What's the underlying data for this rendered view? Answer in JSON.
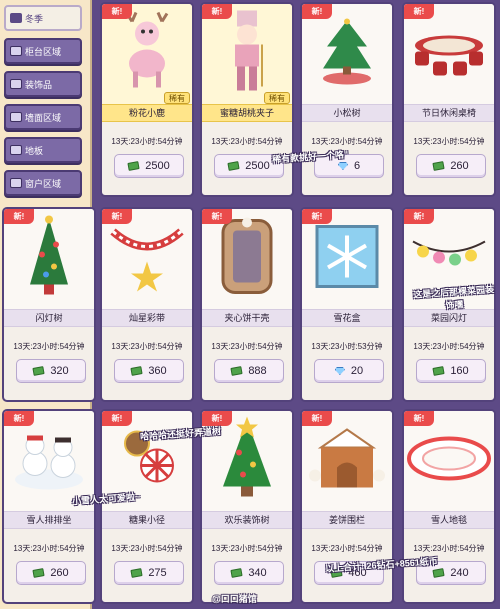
{
  "sidebar": {
    "items": [
      {
        "label": "冬季",
        "icon": "snowflake-icon"
      },
      {
        "label": "柜台区域",
        "icon": "counter-icon"
      },
      {
        "label": "装饰品",
        "icon": "decoration-icon"
      },
      {
        "label": "墙面区域",
        "icon": "wall-icon"
      },
      {
        "label": "地板",
        "icon": "floor-icon"
      },
      {
        "label": "窗户区域",
        "icon": "window-icon"
      }
    ]
  },
  "badges": {
    "new": "新!",
    "rare": "稀有"
  },
  "items": [
    {
      "name": "粉花小鹿",
      "timer": "13天:23小时:54分钟",
      "price": "2500",
      "currency": "cash",
      "rare": true
    },
    {
      "name": "蜜糖胡桃夹子",
      "timer": "13天:23小时:54分钟",
      "price": "2500",
      "currency": "cash",
      "rare": true
    },
    {
      "name": "小松树",
      "timer": "13天:23小时:54分钟",
      "price": "6",
      "currency": "gem",
      "rare": false
    },
    {
      "name": "节日休闲桌椅",
      "timer": "13天:23小时:54分钟",
      "price": "260",
      "currency": "cash",
      "rare": false
    },
    {
      "name": "闪灯树",
      "timer": "13天:23小时:54分钟",
      "price": "320",
      "currency": "cash",
      "rare": false
    },
    {
      "name": "灿星彩带",
      "timer": "13天:23小时:54分钟",
      "price": "360",
      "currency": "cash",
      "rare": false
    },
    {
      "name": "夹心饼干壳",
      "timer": "13天:23小时:54分钟",
      "price": "888",
      "currency": "cash",
      "rare": false
    },
    {
      "name": "雪花盒",
      "timer": "13天:23小时:53分钟",
      "price": "20",
      "currency": "gem",
      "rare": false
    },
    {
      "name": "菜园闪灯",
      "timer": "13天:23小时:54分钟",
      "price": "160",
      "currency": "cash",
      "rare": false
    },
    {
      "name": "雪人排排坐",
      "timer": "13天:23小时:54分钟",
      "price": "260",
      "currency": "cash",
      "rare": false
    },
    {
      "name": "糖果小径",
      "timer": "13天:23小时:54分钟",
      "price": "275",
      "currency": "cash",
      "rare": false
    },
    {
      "name": "欢乐装饰树",
      "timer": "13天:23小时:54分钟",
      "price": "340",
      "currency": "cash",
      "rare": false
    },
    {
      "name": "姜饼围栏",
      "timer": "13天:23小时:54分钟",
      "price": "460",
      "currency": "cash",
      "rare": false
    },
    {
      "name": "雪人地毯",
      "timer": "13天:23小时:54分钟",
      "price": "240",
      "currency": "cash",
      "rare": false
    }
  ],
  "captions": {
    "c1": "稀有款挑好一个咯\"",
    "c2": "这是之后那棵菜园装饰嘿",
    "c3": "哈哈哈还挺好弄道树",
    "c4": "小雪人太可爱啦~",
    "c5": "以上合计: 26钻石+8561纸币",
    "watermark": "@口口猪馆"
  }
}
